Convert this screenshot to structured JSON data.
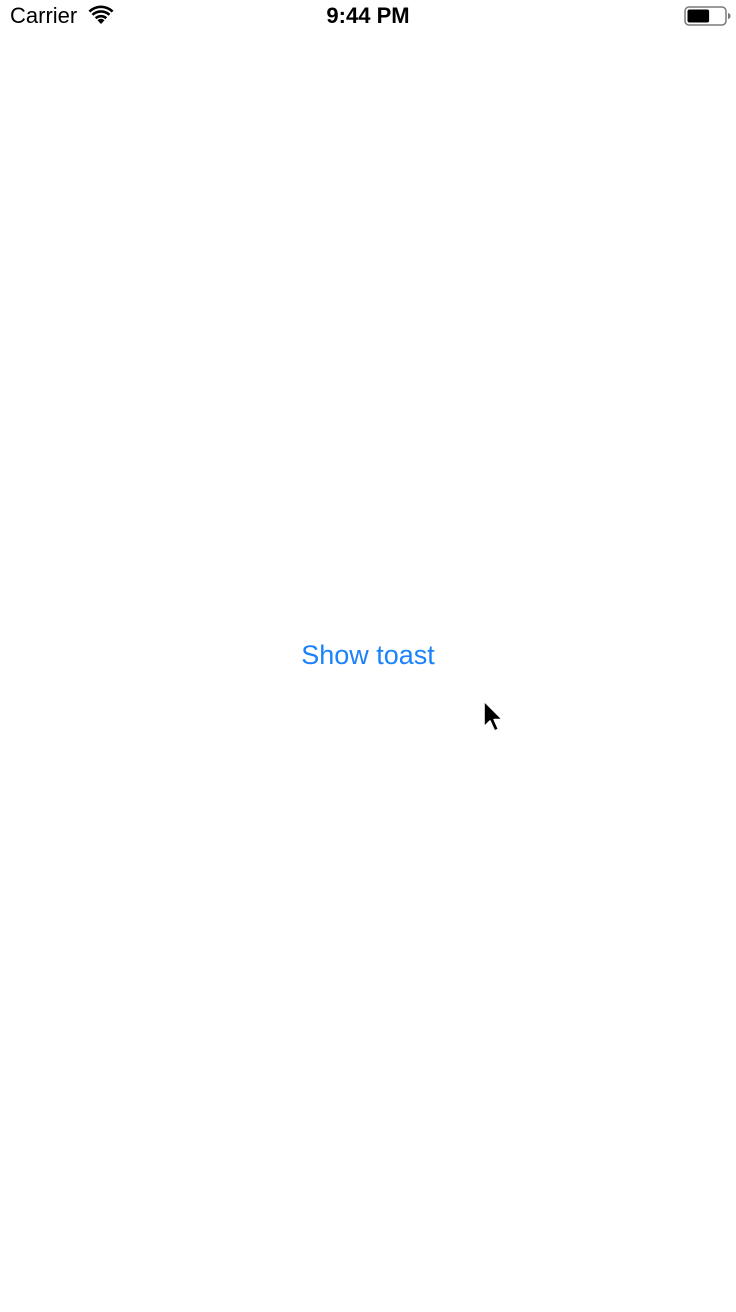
{
  "status_bar": {
    "carrier": "Carrier",
    "time": "9:44 PM",
    "wifi_icon": "wifi-icon",
    "battery_icon": "battery-icon",
    "battery_level": 0.6
  },
  "main": {
    "show_toast_label": "Show toast"
  },
  "colors": {
    "accent": "#1a82fb",
    "background": "#ffffff",
    "text": "#000000"
  },
  "cursor_icon": "mouse-pointer-icon"
}
